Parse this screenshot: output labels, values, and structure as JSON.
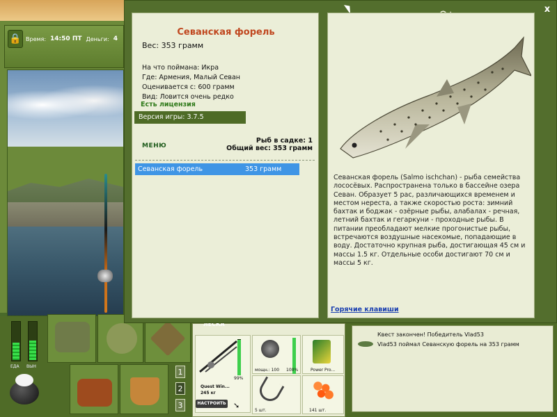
{
  "hud": {
    "time_label": "Время:",
    "time_value": "14:50 ПТ",
    "money_label": "Деньги:",
    "money_value": "4"
  },
  "catch_window": {
    "fish_name": "Севанская форель",
    "weight": "Вес: 353 грамм",
    "info": [
      "На что поймана: Икра",
      "Где: Армения, Малый Севан",
      "Оценивается с: 600 грамм",
      "Вид: Ловится очень редко"
    ],
    "license": "Есть лицензия",
    "version": "Версия игры: 3.7.5",
    "menu_label": "МЕНЮ",
    "keep_net_count": "Рыб в садке: 1",
    "keep_net_total": "Общий вес: 353 грамм",
    "catch_list": [
      {
        "name": "Севанская форель",
        "weight": "353 грамм"
      }
    ],
    "description": "Севанская форель (Salmo ischchan) - рыба семейства лососёвых. Распространена только в бассейне озера Севан. Образует 5 рас, различающихся временем и местом нереста, а также скоростью роста: зимний бахтак и боджак - озёрные рыбы, алабалах - речная, летний бахтак и гегаркуни - проходные рыбы. В питании преобладают мелкие прогонистые рыбы, встречаются воздушные насекомые, попадающие в воду. Достаточно крупная рыба, достигающая 45 см и массы 1.5 кг. Отдельные особи достигают 70 см и массы 5 кг.",
    "hotkeys_link": "Горячие клавиши",
    "close_label": "x"
  },
  "needs": {
    "food_label": "ЕДА",
    "stamina_label": "ВЫН",
    "food_level": 0.45,
    "stamina_level": 0.5
  },
  "quick_slots": [
    "1",
    "2",
    "3"
  ],
  "tackle": {
    "header": "ЛЕСКА",
    "rod_name": "Quest Win...",
    "rod_load": "245 кг",
    "rod_percent": "99%",
    "reel_label": "мощн.: 100",
    "reel_percent": "100%",
    "line_name": "Power Pro...",
    "hook_count": "5 шт.",
    "bait_count": "141 шт.",
    "setup_button": "НАСТРОИТЬ"
  },
  "quest_log": [
    "Квест закончен! Победитель Vlad53",
    "Vlad53 поймал Севанскую форель на 353 грамм"
  ],
  "colors": {
    "title": "#c0471f",
    "license": "#2f7a1a",
    "selection": "#3f95e5",
    "link": "#1a3fb0"
  }
}
